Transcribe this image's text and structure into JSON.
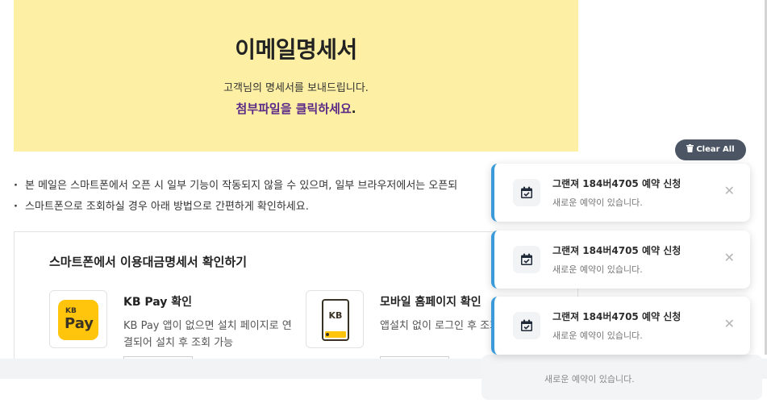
{
  "hero": {
    "title": "이메일명세서",
    "subtitle": "고객님의 명세서를 보내드립니다.",
    "link_text": "첨부파일을 클릭하세요",
    "link_dot": "."
  },
  "notes": [
    "본 메일은 스마트폰에서 오픈 시 일부 기능이 작동되지 않을 수 있으며, 일부 브라우저에서는 오픈되",
    "스마트폰으로 조회하실 경우 아래 방법으로 간편하게 확인하세요."
  ],
  "smartphone": {
    "title": "스마트폰에서 이용대금명세서 확인하기",
    "options": [
      {
        "icon": "kb-pay-icon",
        "icon_top": "KB",
        "icon_bottom": "Pay",
        "name": "KB Pay 확인",
        "desc": "KB Pay 앱이 없으면 설치 페이지로 연결되어 설치 후 조회 가능"
      },
      {
        "icon": "mobile-kb-icon",
        "icon_top": "KB",
        "name": "모바일 홈페이지 확인",
        "desc": "앱설치 없이 로그인 후 조회 가능"
      }
    ]
  },
  "notifications": {
    "clear_all_label": "Clear All",
    "items": [
      {
        "icon": "calendar-check-icon",
        "title": "그랜져 184버4705 예약 신청",
        "message": "새로운 예약이 있습니다."
      },
      {
        "icon": "calendar-check-icon",
        "title": "그랜져 184버4705 예약 신청",
        "message": "새로운 예약이 있습니다."
      },
      {
        "icon": "calendar-check-icon",
        "title": "그랜져 184버4705 예약 신청",
        "message": "새로운 예약이 있습니다."
      }
    ],
    "hidden_item_message": "새로운 예약이 있습니다.",
    "close_glyph": "✕"
  },
  "colors": {
    "hero_bg": "#fdf0a5",
    "link": "#5b2a86",
    "toast_accent": "#3b9ad9",
    "clear_all_bg": "#4b5563",
    "kb_yellow": "#ffc40c"
  }
}
